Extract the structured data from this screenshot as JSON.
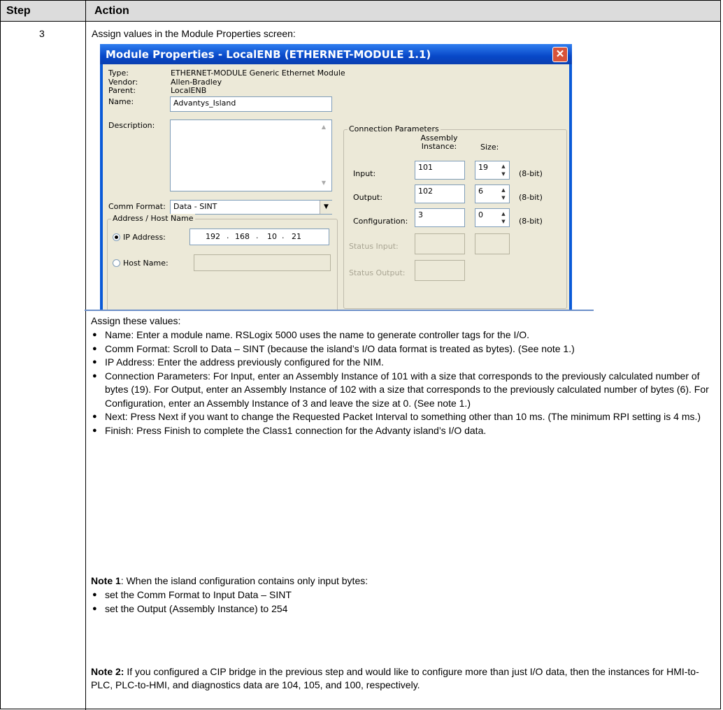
{
  "table": {
    "header": {
      "step": "Step",
      "action": "Action"
    },
    "step_number": "3",
    "intro": "Assign values in the Module Properties screen:"
  },
  "dialog": {
    "title": "Module Properties  - LocalENB (ETHERNET-MODULE 1.1)",
    "close_glyph": "✕",
    "type_label": "Type:",
    "type_value": "ETHERNET-MODULE Generic Ethernet Module",
    "vendor_label": "Vendor:",
    "vendor_value": "Allen-Bradley",
    "parent_label": "Parent:",
    "parent_value": "LocalENB",
    "name_label": "Name:",
    "name_value": "Advantys_Island",
    "description_label": "Description:",
    "description_value": "",
    "comm_format_label": "Comm Format:",
    "comm_format_value": "Data - SINT",
    "address_group_title": "Address / Host Name",
    "ip_address_label": "IP Address:",
    "ip_octets": [
      "192",
      "168",
      "10",
      "21"
    ],
    "host_name_label": "Host Name:",
    "conn_group_title": "Connection Parameters",
    "assembly_instance_header": "Assembly Instance:",
    "size_header": "Size:",
    "input_label": "Input:",
    "input_instance": "101",
    "input_size": "19",
    "output_label": "Output:",
    "output_instance": "102",
    "output_size": "6",
    "config_label": "Configuration:",
    "config_instance": "3",
    "config_size": "0",
    "unit": "(8-bit)",
    "status_input_label": "Status Input:",
    "status_output_label": "Status Output:"
  },
  "content": {
    "assign_heading": "Assign these values:",
    "bullets": [
      "Name: Enter a module name. RSLogix 5000 uses the name to generate controller tags for the I/O.",
      "Comm Format: Scroll to Data – SINT (because the island’s I/O data format is treated as bytes). (See note 1.)",
      "IP Address: Enter the address previously configured for the NIM.",
      "Connection Parameters: For Input, enter an Assembly Instance of 101 with a size that corresponds to the previously calculated number of bytes (19). For Output, enter an Assembly Instance of 102 with a size that corresponds to the previously calculated number of bytes (6). For Configuration, enter an Assembly Instance of 3 and leave the size at 0. (See note 1.)",
      "Next: Press Next if you want to change the Requested Packet Interval to something other than 10 ms. (The minimum RPI setting is 4 ms.)",
      "Finish: Press Finish to complete the Class1 connection for the Advanty island’s I/O data."
    ],
    "note1_label": "Note 1",
    "note1_text": ": When the island configuration contains only input bytes:",
    "note1_bullets": [
      "set the Comm Format to Input Data – SINT",
      "set the Output (Assembly Instance) to 254"
    ],
    "note2_label": "Note 2:",
    "note2_text": " If you configured a CIP bridge in the previous step and would like to configure more than just I/O data, then the instances for HMI-to-PLC, PLC-to-HMI, and diagnostics data are 104, 105, and 100, respectively."
  }
}
